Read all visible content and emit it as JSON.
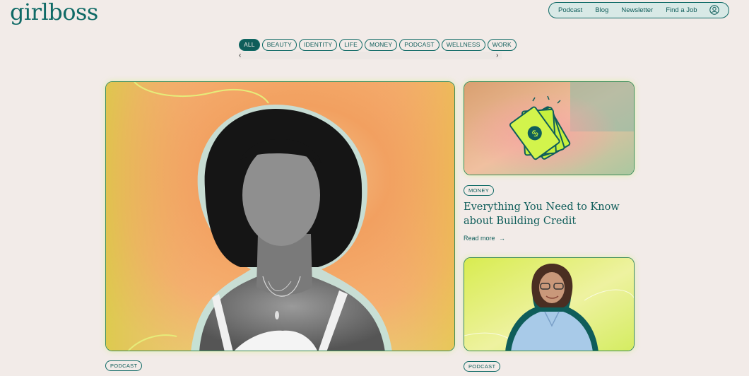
{
  "brand": {
    "logo": "girlboss"
  },
  "nav": {
    "items": [
      "Podcast",
      "Blog",
      "Newsletter",
      "Find a Job"
    ],
    "user_icon": "user-circle-icon"
  },
  "filters": {
    "active": "ALL",
    "tags": [
      "ALL",
      "BEAUTY",
      "IDENTITY",
      "LIFE",
      "MONEY",
      "PODCAST",
      "WELLNESS",
      "WORK"
    ],
    "prev_icon": "chevron-left-icon",
    "next_icon": "chevron-right-icon"
  },
  "featured": {
    "category": "PODCAST"
  },
  "side_article": {
    "category": "MONEY",
    "title": "Everything You Need to Know about Building Credit",
    "cta": "Read more",
    "cta_icon": "arrow-right-icon"
  },
  "side_article_2": {
    "category": "PODCAST"
  },
  "colors": {
    "brand_teal": "#0f5d5a",
    "background": "#f2ebe8",
    "accent_lime": "#c8f04a"
  }
}
